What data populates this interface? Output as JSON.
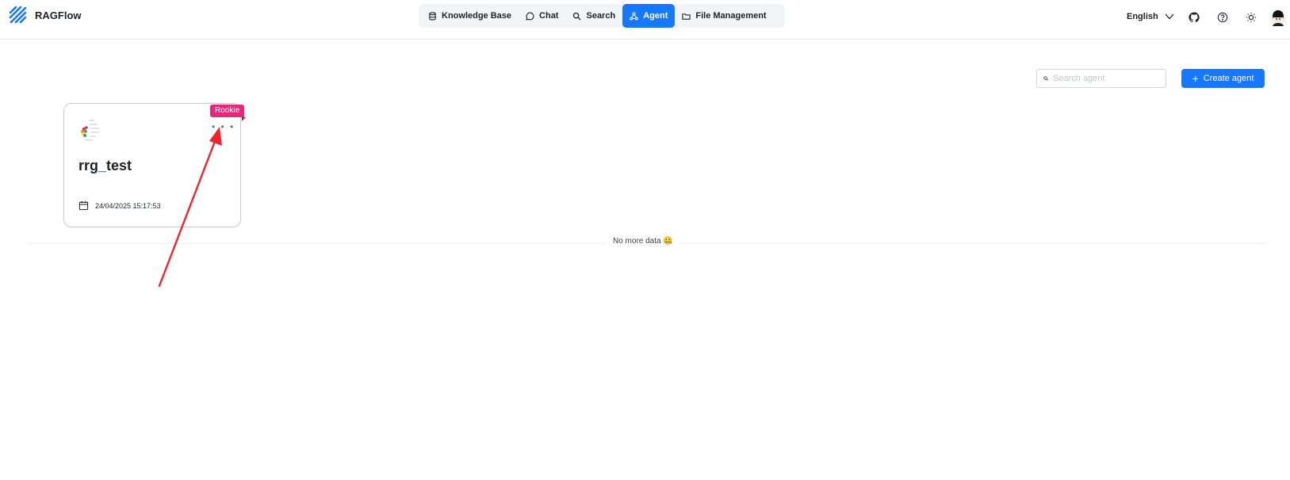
{
  "app": {
    "name": "RAGFlow"
  },
  "nav": {
    "items": [
      {
        "label": "Knowledge Base",
        "icon": "database-icon",
        "active": false
      },
      {
        "label": "Chat",
        "icon": "chat-bubble-icon",
        "active": false
      },
      {
        "label": "Search",
        "icon": "search-icon",
        "active": false
      },
      {
        "label": "Agent",
        "icon": "agent-graph-icon",
        "active": true
      },
      {
        "label": "File Management",
        "icon": "folder-icon",
        "active": false
      }
    ]
  },
  "header": {
    "language": "English",
    "icons": [
      "github-icon",
      "help-circle-icon",
      "sun-icon",
      "avatar"
    ]
  },
  "toolbar": {
    "search_placeholder": "Search agent",
    "create_label": "Create agent"
  },
  "agents": [
    {
      "title": "rrg_test",
      "date": "24/04/2025 15:17:53",
      "badge": "Rookie",
      "more": "• • •"
    }
  ],
  "footer": {
    "no_more": "No more data 🤐"
  },
  "colors": {
    "accent": "#1677ff",
    "badge": "#e6277a",
    "annotation_arrow": "#f5222d"
  }
}
